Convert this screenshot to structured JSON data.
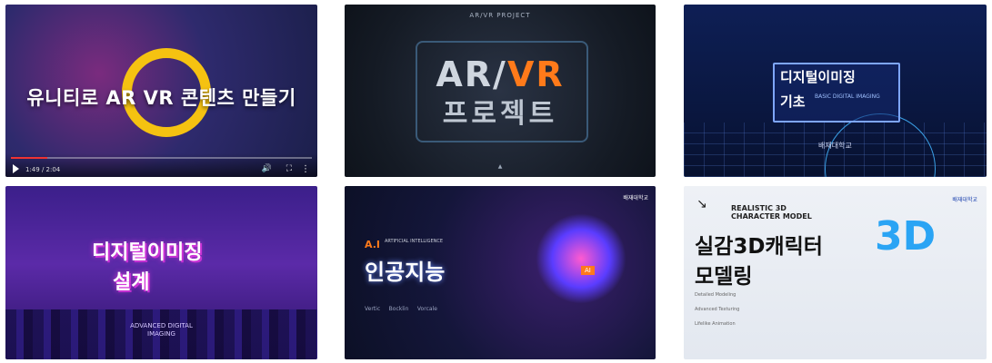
{
  "cards": [
    {
      "title": "유니티로 AR VR 콘텐츠 만들기",
      "player": {
        "time": "1:49 / 2:04",
        "progress": 0.12
      }
    },
    {
      "eyebrow": "AR/VR PROJECT",
      "title_main": "AR/",
      "title_accent": "VR",
      "subtitle": "프로젝트"
    },
    {
      "line1": "디지털이미징",
      "line2": "기초",
      "subtitle": "BASIC DIGITAL IMAGING",
      "logo": "배재대학교"
    },
    {
      "line1": "디지털이미징",
      "line2": "설계",
      "subtitle": "ADVANCED DIGITAL IMAGING"
    },
    {
      "tag": "A.I",
      "tag_sub": "ARTIFICIAL INTELLIGENCE",
      "title": "인공지능",
      "badge": "AI",
      "logo": "배재대학교",
      "icons": [
        "Vertic",
        "Bocklin",
        "Vorcale"
      ]
    },
    {
      "eyebrow": "REALISTIC 3D CHARACTER MODEL",
      "line1": "실감3D캐릭터",
      "line2": "모델링",
      "big": "3D",
      "logo": "배재대학교",
      "details": [
        "Detailed Modeling",
        "Advanced Texturing",
        "Lifelike Animation"
      ]
    }
  ]
}
